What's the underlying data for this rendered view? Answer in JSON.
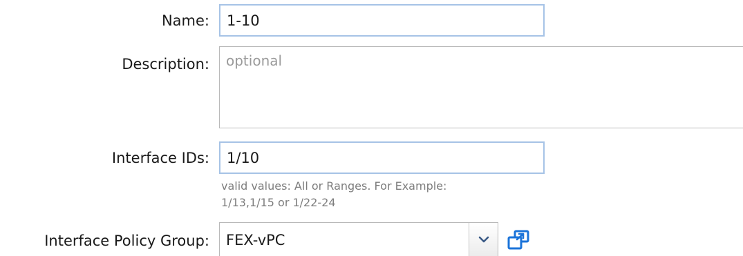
{
  "form": {
    "name": {
      "label": "Name:",
      "value": "1-10"
    },
    "description": {
      "label": "Description:",
      "value": "",
      "placeholder": "optional"
    },
    "interface_ids": {
      "label": "Interface IDs:",
      "value": "1/10",
      "hint_line1": "valid values: All or Ranges. For Example:",
      "hint_line2": "1/13,1/15 or 1/22-24"
    },
    "interface_policy_group": {
      "label": "Interface Policy Group:",
      "selected": "FEX-vPC"
    }
  },
  "icons": {
    "dropdown": "chevron-down-icon",
    "open_window": "open-in-new-window-icon"
  },
  "colors": {
    "focused_border": "#a6c3e6",
    "field_border": "#b9b9b9",
    "icon_blue": "#1a73d9",
    "hint_text": "#7d7d7d",
    "placeholder_text": "#9a9a9a"
  }
}
